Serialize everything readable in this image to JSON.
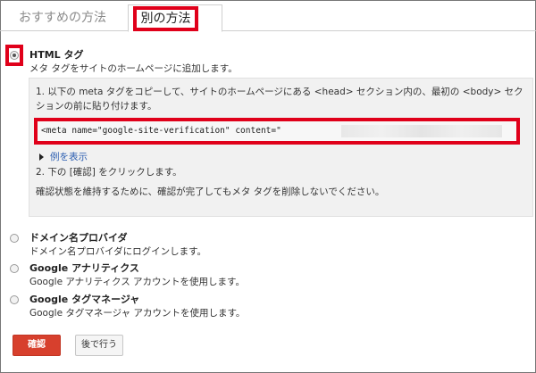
{
  "tabs": {
    "recommended": "おすすめの方法",
    "alternate": "別の方法"
  },
  "options": [
    {
      "title": "HTML タグ",
      "desc": "メタ タグをサイトのホームページに追加します。",
      "selected": true
    },
    {
      "title": "ドメイン名プロバイダ",
      "desc": "ドメイン名プロバイダにログインします。",
      "selected": false
    },
    {
      "title": "Google アナリティクス",
      "desc": "Google アナリティクス アカウントを使用します。",
      "selected": false
    },
    {
      "title": "Google タグマネージャ",
      "desc": "Google タグマネージャ アカウントを使用します。",
      "selected": false
    }
  ],
  "instructions": {
    "step1": "1. 以下の meta タグをコピーして、サイトのホームページにある <head> セクション内の、最初の <body> セクションの前に貼り付けます。",
    "code": "<meta name=\"google-site-verification\" content=\"",
    "example_link": "例を表示",
    "step2": "2. 下の [確認] をクリックします。",
    "note": "確認状態を維持するために、確認が完了してもメタ タグを削除しないでください。"
  },
  "buttons": {
    "confirm": "確認",
    "later": "後で行う"
  },
  "colors": {
    "highlight": "#e0001a",
    "confirm_button": "#d7402d",
    "link": "#2a5db0"
  }
}
